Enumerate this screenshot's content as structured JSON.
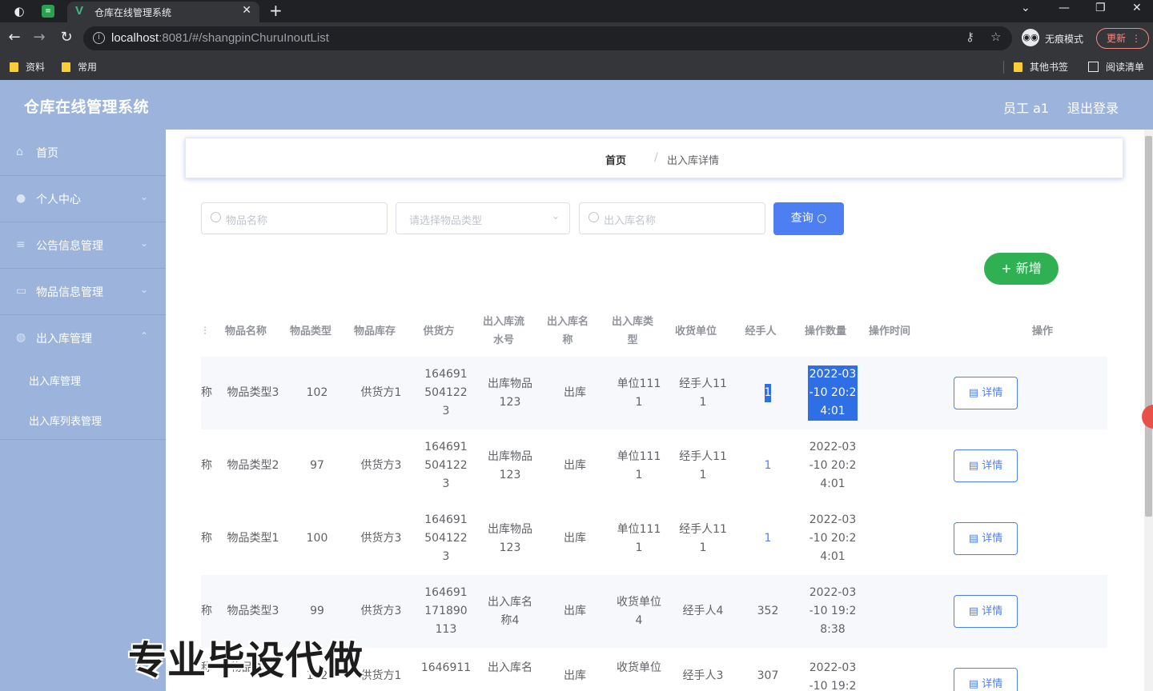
{
  "browser": {
    "tab_title": "仓库在线管理系统",
    "url_host": "localhost",
    "url_path": ":8081/#/shangpinChuruInoutList",
    "incognito_label": "无痕模式",
    "update_label": "更新",
    "bookmarks": [
      "资料",
      "常用"
    ],
    "other_bookmarks": "其他书签",
    "reading_list": "阅读清单"
  },
  "header": {
    "title": "仓库在线管理系统",
    "user": "员工 a1",
    "logout": "退出登录"
  },
  "sidebar": {
    "items": [
      {
        "label": "首页",
        "icon": "home-icon"
      },
      {
        "label": "个人中心",
        "icon": "user-icon"
      },
      {
        "label": "公告信息管理",
        "icon": "notice-icon"
      },
      {
        "label": "物品信息管理",
        "icon": "goods-icon"
      },
      {
        "label": "出入库管理",
        "icon": "warehouse-icon"
      }
    ],
    "sub_items": [
      "出入库管理",
      "出入库列表管理"
    ]
  },
  "breadcrumb": {
    "home": "首页",
    "separator": "/",
    "current": "出入库详情"
  },
  "search": {
    "name_placeholder": "物品名称",
    "type_placeholder": "请选择物品类型",
    "inout_placeholder": "出入库名称",
    "query_label": "查询",
    "add_label": "新增"
  },
  "table": {
    "columns": [
      "物品名称",
      "物品类型",
      "物品库存",
      "供货方",
      "出入库流水号",
      "出入库名称",
      "出入库类型",
      "收货单位",
      "经手人",
      "操作数量",
      "操作时间",
      "操作"
    ],
    "detail_label": "详情",
    "rows": [
      {
        "name": "称",
        "type": "物品类型3",
        "stock": "102",
        "supplier": "供货方1",
        "serial": "1646915041223",
        "inout_name": "出库物品123",
        "inout_type": "出库",
        "receiver": "单位1111",
        "handler": "经手人111",
        "qty": "1",
        "time": "2022-03-10 20:24:01"
      },
      {
        "name": "称",
        "type": "物品类型2",
        "stock": "97",
        "supplier": "供货方3",
        "serial": "1646915041223",
        "inout_name": "出库物品123",
        "inout_type": "出库",
        "receiver": "单位1111",
        "handler": "经手人111",
        "qty": "1",
        "time": "2022-03-10 20:24:01"
      },
      {
        "name": "称",
        "type": "物品类型1",
        "stock": "100",
        "supplier": "供货方3",
        "serial": "1646915041223",
        "inout_name": "出库物品123",
        "inout_type": "出库",
        "receiver": "单位1111",
        "handler": "经手人111",
        "qty": "1",
        "time": "2022-03-10 20:24:01"
      },
      {
        "name": "称",
        "type": "物品类型3",
        "stock": "99",
        "supplier": "供货方3",
        "serial": "164691171890113",
        "inout_name": "出入库名称4",
        "inout_type": "出库",
        "receiver": "收货单位4",
        "handler": "经手人4",
        "qty": "352",
        "time": "2022-03-10 19:28:38"
      },
      {
        "name": "称",
        "type": "物品类型",
        "stock": "102",
        "supplier": "供货方1",
        "serial": "1646911",
        "inout_name": "出入库名",
        "inout_type": "出库",
        "receiver": "收货单位",
        "handler": "经手人3",
        "qty": "307",
        "time": "2022-03-10 19:2"
      }
    ]
  },
  "watermark": "专业毕设代做"
}
